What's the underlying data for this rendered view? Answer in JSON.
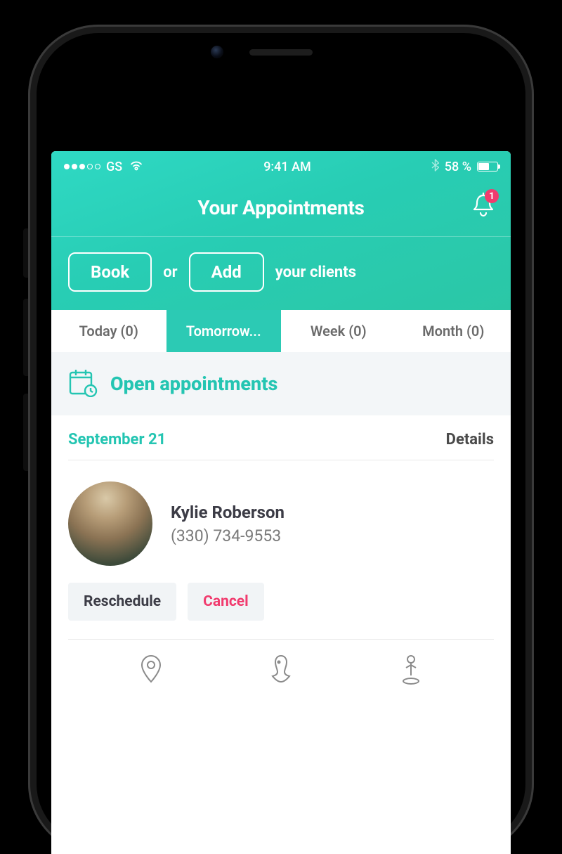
{
  "status_bar": {
    "carrier": "GS",
    "time": "9:41 AM",
    "battery_pct": "58 %"
  },
  "header": {
    "title": "Your Appointments",
    "notif_count": "1",
    "book_label": "Book",
    "or_label": "or",
    "add_label": "Add",
    "suffix": "your clients"
  },
  "tabs": {
    "today": "Today (0)",
    "tomorrow": "Tomorrow...",
    "week": "Week (0)",
    "month": "Month (0)"
  },
  "section": {
    "open_title": "Open appointments"
  },
  "appointment": {
    "date": "September 21",
    "details_label": "Details",
    "client_name": "Kylie Roberson",
    "client_phone": "(330) 734-9553",
    "reschedule_label": "Reschedule",
    "cancel_label": "Cancel"
  }
}
